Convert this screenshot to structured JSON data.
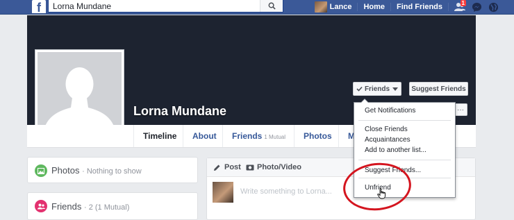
{
  "topbar": {
    "logo": "f",
    "search_value": "Lorna Mundane",
    "user_name": "Lance",
    "home": "Home",
    "find_friends": "Find Friends",
    "friend_requests_badge": "1",
    "icons": [
      "friend-requests-icon",
      "messenger-icon",
      "globe-icon"
    ]
  },
  "profile": {
    "name": "Lorna Mundane",
    "friends_button": "Friends",
    "suggest_button": "Suggest Friends",
    "more_button": "···"
  },
  "tabs": {
    "timeline": "Timeline",
    "about": "About",
    "friends": "Friends",
    "friends_sub": "1 Mutual",
    "photos": "Photos",
    "more": "M"
  },
  "dropdown": {
    "items": [
      "Get Notifications",
      "Close Friends",
      "Acquaintances",
      "Add to another list...",
      "Suggest Friends...",
      "Unfriend"
    ]
  },
  "left": {
    "photos_title": "Photos",
    "photos_sub": "· Nothing to show",
    "friends_title": "Friends",
    "friends_sub": "· 2 (1 Mutual)"
  },
  "composer": {
    "post_tab": "Post",
    "photo_tab": "Photo/Video",
    "placeholder": "Write something to Lorna..."
  },
  "colors": {
    "brand": "#3b5998",
    "highlight": "#d4151f",
    "photos_icon": "#5fb85f",
    "friends_icon": "#e3316f"
  }
}
